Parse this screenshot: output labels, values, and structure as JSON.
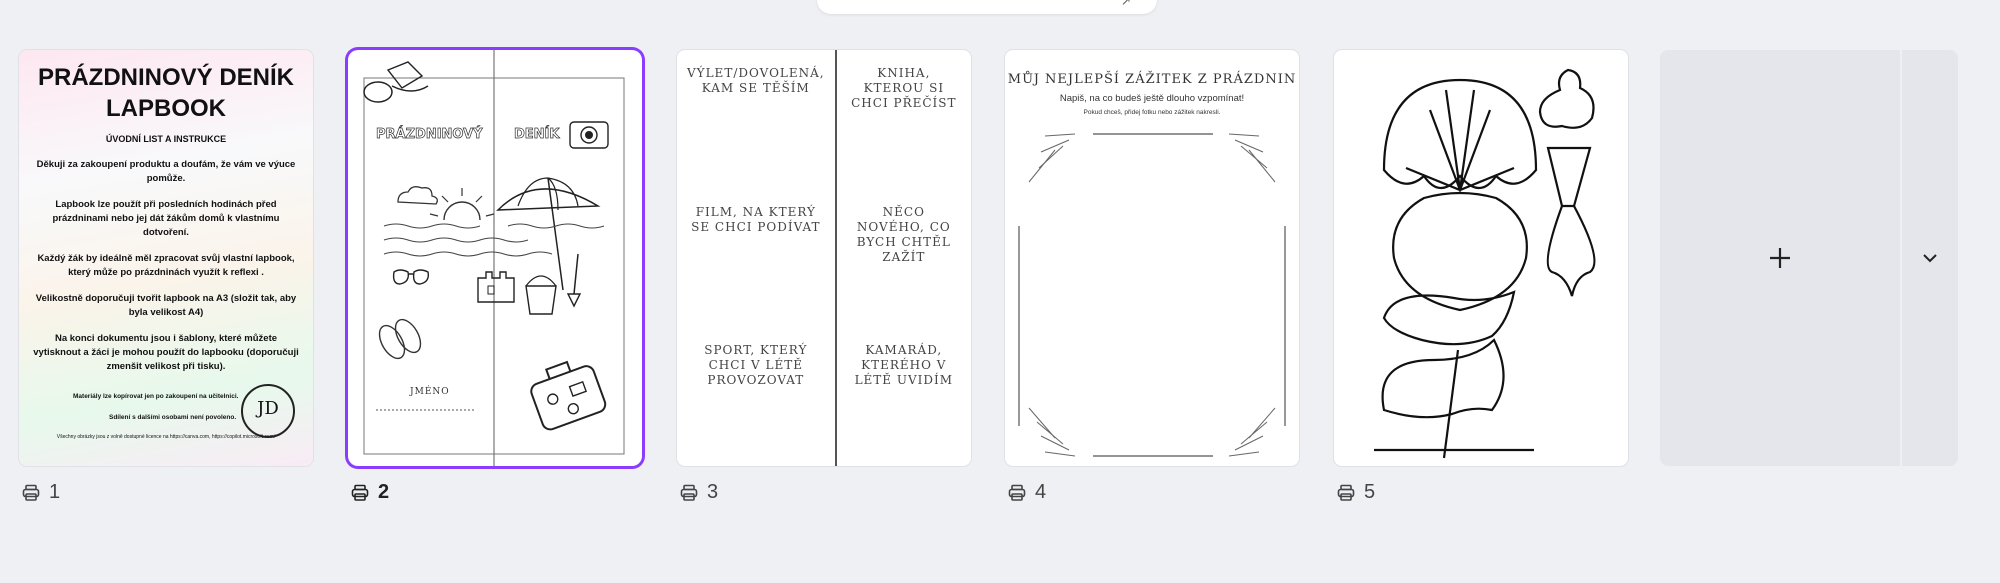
{
  "pages": [
    {
      "number": "1",
      "title": "PRÁZDNINOVÝ DENÍK LAPBOOK",
      "subtitle": "ÚVODNÍ LIST A INSTRUKCE",
      "paragraphs": [
        "Děkuji za zakoupení produktu a doufám, že vám ve výuce pomůže.",
        "Lapbook lze použít při posledních hodinách před prázdninami nebo jej dát žákům domů k vlastnímu dotvoření.",
        "Každý žák by ideálně měl zpracovat svůj vlastní lapbook, který může po prázdninách využít k reflexi .",
        "Velikostně doporučuji tvořit lapbook na A3 (složit tak, aby byla velikost A4)",
        "Na konci dokumentu jsou i šablony, které můžete vytisknout a žáci je mohou použít do lapbooku (doporučuji zmenšit velikost při tisku)."
      ],
      "small1": "Materiály lze kopírovat jen po zakoupení na učitelnici.",
      "small2": "Sdílení s dalšími osobami není povoleno.",
      "tiny": "Všechny obrázky jsou z volně dostupné licence na https://canva.com, https://copilot.microsoft.com/",
      "monogram": "JD"
    },
    {
      "number": "2",
      "heading_left": "PRÁZDNINOVÝ",
      "heading_right": "DENÍK",
      "name_label": "JMÉNO",
      "selected": true
    },
    {
      "number": "3",
      "cells_left": [
        "VÝLET/DOVOLENÁ, KAM SE TĚŠÍM",
        "FILM, NA KTERÝ SE CHCI PODÍVAT",
        "SPORT, KTERÝ CHCI V LÉTĚ PROVOZOVAT"
      ],
      "cells_right": [
        "KNIHA, KTEROU SI CHCI PŘEČÍST",
        "NĚCO NOVÉHO, CO BYCH CHTĚL ZAŽÍT",
        "KAMARÁD, KTERÉHO V LÉTĚ UVIDÍM"
      ]
    },
    {
      "number": "4",
      "title": "MŮJ NEJLEPŠÍ ZÁŽITEK Z PRÁZDNIN",
      "subtitle": "Napiš, na co budeš ještě dlouho vzpomínat!",
      "note": "Pokud chceš, přidej fotku nebo zážitek nakresli."
    },
    {
      "number": "5"
    }
  ],
  "add_page": {
    "icon": "plus-icon",
    "more_icon": "chevron-down-icon"
  },
  "colors": {
    "accent": "#8b3dff",
    "background": "#eff0f4"
  }
}
